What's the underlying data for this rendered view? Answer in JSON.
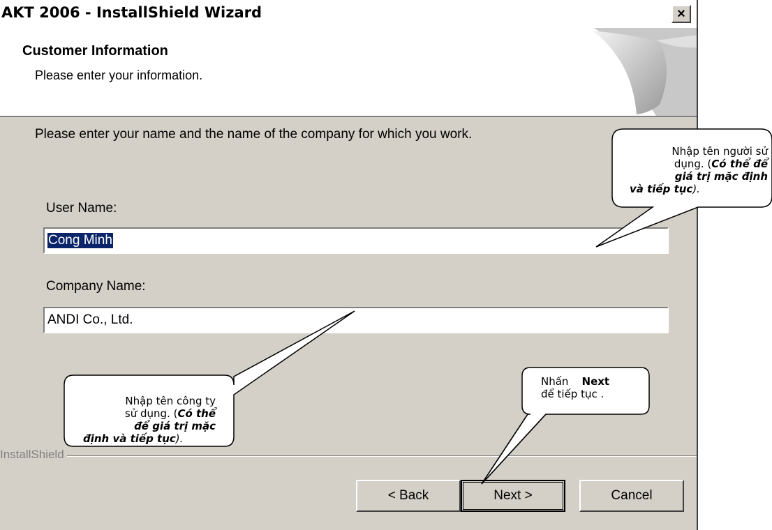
{
  "window": {
    "title": "AKT 2006 - InstallShield Wizard",
    "close_label": "×"
  },
  "header": {
    "title": "Customer Information",
    "subtitle": "Please enter your information."
  },
  "body": {
    "instruction": "Please enter your name and the name of the company for which you work.",
    "user_name": {
      "label": "User Name:",
      "value": "Cong Minh"
    },
    "company_name": {
      "label": "Company Name:",
      "value": "ANDI Co., Ltd."
    }
  },
  "footer": {
    "brand": "InstallShield",
    "back_label": "< Back",
    "next_label": "Next >",
    "cancel_label": "Cancel"
  },
  "callouts": {
    "user": {
      "line1": "Nhập tên người sử",
      "line2a": "dụng. (",
      "line2b": "Có thể để",
      "line3": "giá trị mặc định",
      "line4a": "và tiếp tục",
      "line4b": ")."
    },
    "company": {
      "line1": "Nhập tên công ty",
      "line2a": "sử dụng. (",
      "line2b": "Có thể",
      "line3": "để giá trị mặc",
      "line4a": "định và tiếp tục",
      "line4b": ")."
    },
    "next": {
      "line1a": "Nhấn",
      "line1b": "Next",
      "line2": "để tiếp tục ."
    }
  }
}
